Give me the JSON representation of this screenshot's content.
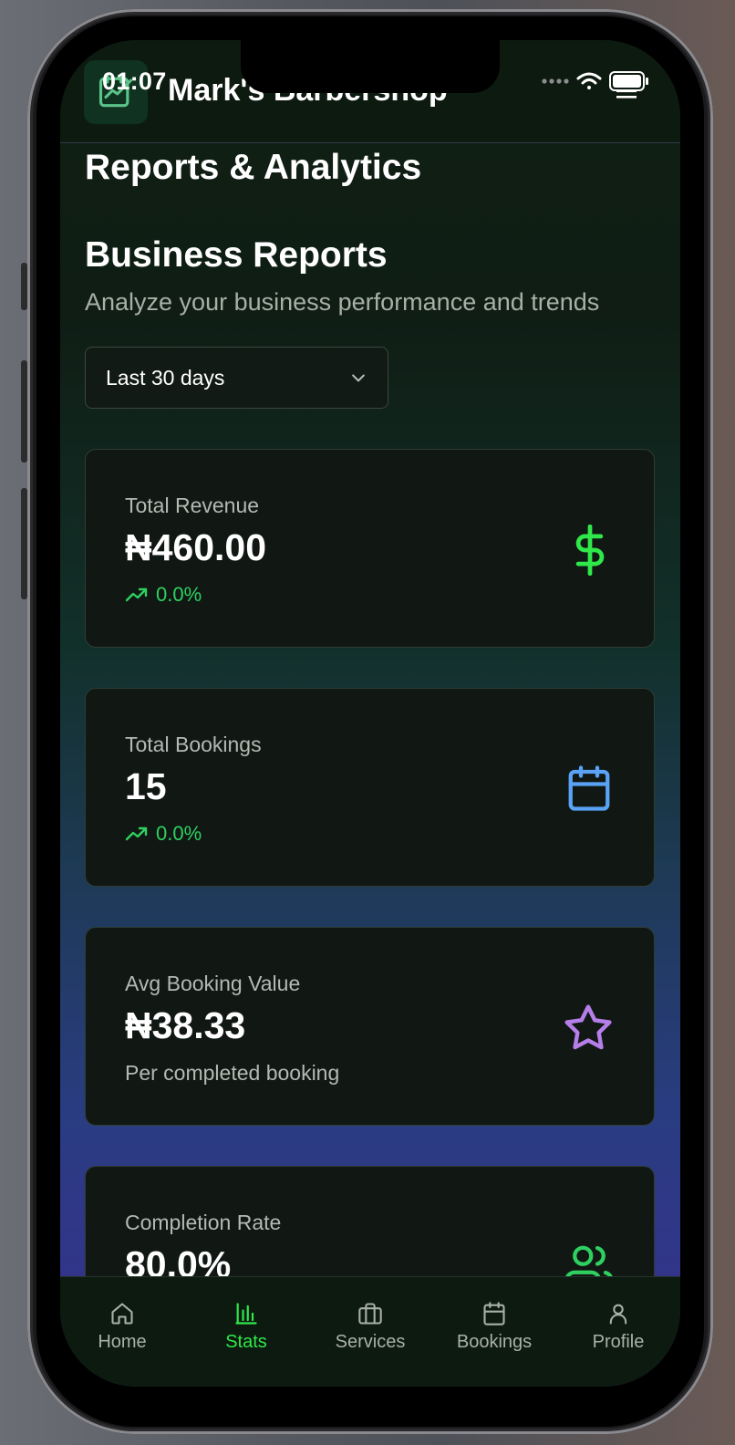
{
  "status_bar": {
    "time": "01:07"
  },
  "header": {
    "title": "Mark's Barbershop",
    "logo_icon": "calendar-chart-icon",
    "menu_icon": "menu-icon"
  },
  "page": {
    "heading": "Reports & Analytics",
    "section_title": "Business Reports",
    "section_subtitle": "Analyze your business performance and trends"
  },
  "range_select": {
    "value": "Last 30 days",
    "icon": "chevron-down-icon"
  },
  "cards": [
    {
      "label": "Total Revenue",
      "value": "₦460.00",
      "trend": "0.0%",
      "icon": "dollar-icon",
      "icon_color": "#2fe84a"
    },
    {
      "label": "Total Bookings",
      "value": "15",
      "trend": "0.0%",
      "icon": "calendar-icon",
      "icon_color": "#5aa2f5"
    },
    {
      "label": "Avg Booking Value",
      "value": "₦38.33",
      "note": "Per completed booking",
      "icon": "star-icon",
      "icon_color": "#b57ee8"
    },
    {
      "label": "Completion Rate",
      "value": "80.0%",
      "icon": "users-icon",
      "icon_color": "#2fd060"
    }
  ],
  "nav": [
    {
      "label": "Home",
      "icon": "home-icon",
      "active": false
    },
    {
      "label": "Stats",
      "icon": "bar-chart-icon",
      "active": true
    },
    {
      "label": "Services",
      "icon": "briefcase-icon",
      "active": false
    },
    {
      "label": "Bookings",
      "icon": "calendar-icon",
      "active": false
    },
    {
      "label": "Profile",
      "icon": "user-icon",
      "active": false
    }
  ],
  "colors": {
    "accent": "#2fe84a",
    "trend": "#2fd060",
    "header_bg": "#0d1a10",
    "card_bg": "#111814"
  }
}
